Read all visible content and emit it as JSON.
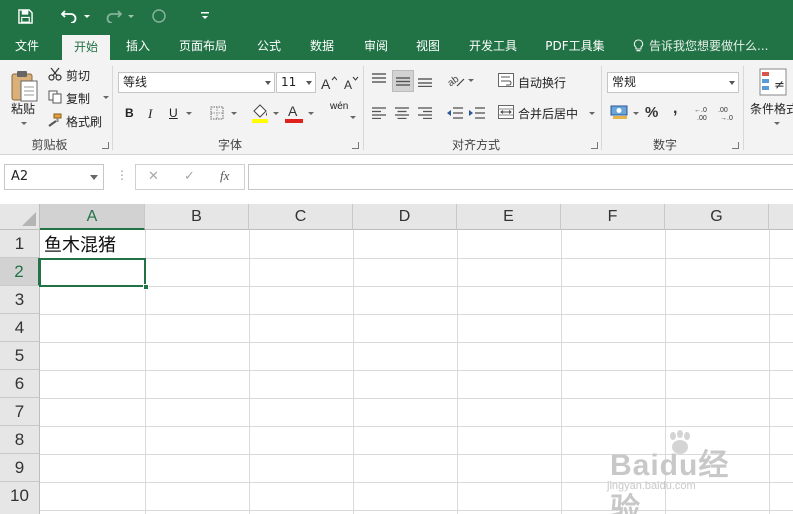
{
  "colors": {
    "excel_green": "#217346",
    "ribbon_bg": "#f3f3f3",
    "header_bg": "#e6e6e6"
  },
  "qat": {
    "save_icon": "save-icon",
    "undo_icon": "undo-icon",
    "redo_icon": "redo-icon",
    "customize_icon": "customize-qat-icon"
  },
  "tabs": [
    {
      "label": "文件",
      "active": false
    },
    {
      "label": "开始",
      "active": true
    },
    {
      "label": "插入",
      "active": false
    },
    {
      "label": "页面布局",
      "active": false
    },
    {
      "label": "公式",
      "active": false
    },
    {
      "label": "数据",
      "active": false
    },
    {
      "label": "审阅",
      "active": false
    },
    {
      "label": "视图",
      "active": false
    },
    {
      "label": "开发工具",
      "active": false
    },
    {
      "label": "PDF工具集",
      "active": false
    }
  ],
  "tell_me": "告诉我您想要做什么...",
  "clipboard": {
    "paste": "粘贴",
    "cut": "剪切",
    "copy": "复制",
    "format_painter": "格式刷",
    "group": "剪贴板"
  },
  "font": {
    "name": "等线",
    "size": "11",
    "bold": "B",
    "italic": "I",
    "underline": "U",
    "font_color": "A",
    "phonetic": "wén",
    "group": "字体"
  },
  "alignment": {
    "wrap": "自动换行",
    "merge": "合并后居中",
    "group": "对齐方式"
  },
  "number": {
    "format": "常规",
    "percent": "%",
    "comma": ",",
    "group": "数字"
  },
  "styles": {
    "conditional": "条件格式"
  },
  "formula_bar": {
    "name_box": "A2",
    "cancel": "✕",
    "enter": "✓",
    "fx": "fx",
    "value": ""
  },
  "grid": {
    "columns": [
      "A",
      "B",
      "C",
      "D",
      "E",
      "F",
      "G"
    ],
    "rows": [
      "1",
      "2",
      "3",
      "4",
      "5",
      "6",
      "7",
      "8",
      "9",
      "10"
    ],
    "selected_cell": "A2",
    "cells": {
      "A1": "鱼木混猪"
    }
  },
  "watermark": {
    "brand": "Baidu经验",
    "url": "jingyan.baidu.com"
  }
}
